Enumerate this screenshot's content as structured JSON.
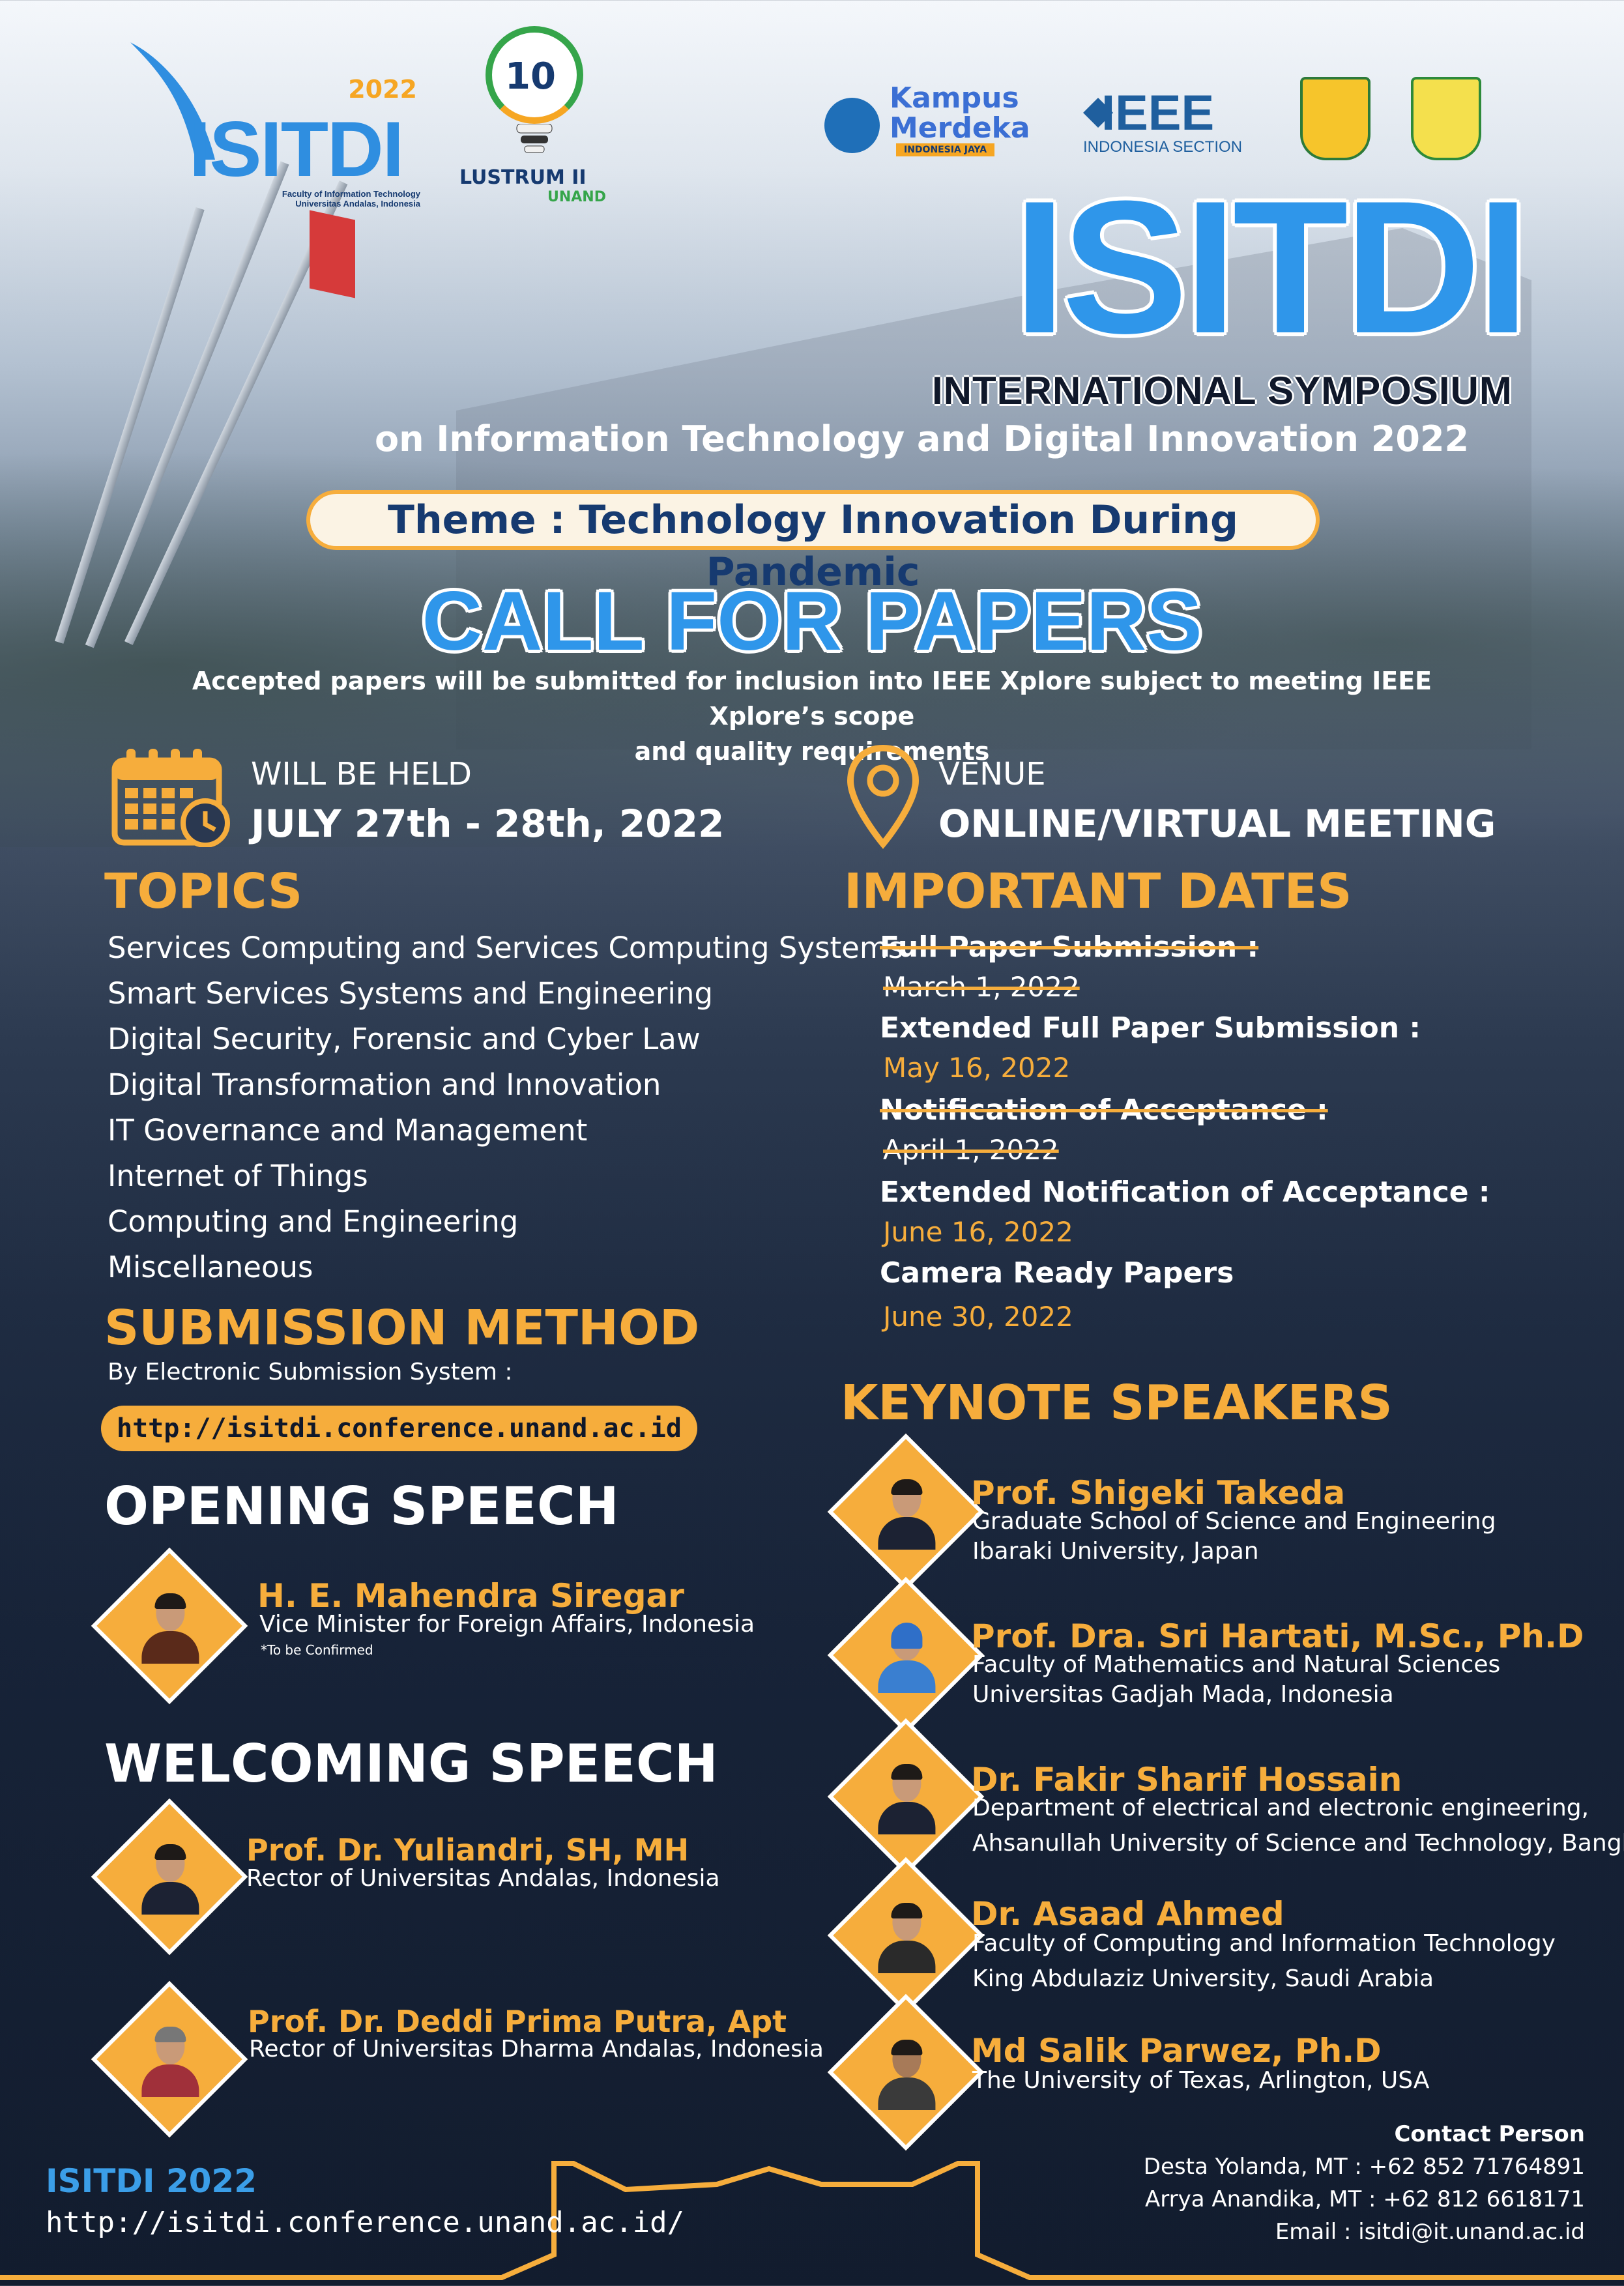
{
  "logos": {
    "isitdi_year": "2022",
    "isitdi_word": "ISITDI",
    "isitdi_sub_1": "Faculty of Information Technology",
    "isitdi_sub_2": "Universitas Andalas, Indonesia",
    "lustrum_number": "10",
    "lustrum_title": "LUSTRUM II",
    "lustrum_unand": "UNAND",
    "kampus_merdeka_1": "Kampus",
    "kampus_merdeka_2": "Merdeka",
    "kampus_merdeka_bar": "INDONESIA JAYA",
    "ieee_word": "IEEE",
    "ieee_sub": "INDONESIA SECTION"
  },
  "headline": {
    "title": "ISITDI",
    "subtitle": "INTERNATIONAL SYMPOSIUM",
    "tagline": "on Information Technology and Digital Innovation 2022",
    "theme": "Theme : Technology Innovation During Pandemic",
    "cfp": "CALL FOR PAPERS",
    "accepted_1": "Accepted papers will be submitted for inclusion into IEEE Xplore subject to meeting IEEE Xplore’s scope",
    "accepted_2": "and quality requirements"
  },
  "event": {
    "held_label": "WILL BE HELD",
    "held_value": "JULY 27th - 28th, 2022",
    "venue_label": "VENUE",
    "venue_value": "ONLINE/VIRTUAL MEETING"
  },
  "topics": {
    "heading": "TOPICS",
    "items": [
      "Services Computing and Services Computing Systems",
      "Smart Services Systems and Engineering",
      "Digital Security, Forensic and Cyber Law",
      "Digital Transformation and Innovation",
      "IT Governance and Management",
      "Internet of Things",
      "Computing and Engineering",
      "Miscellaneous"
    ]
  },
  "submission": {
    "heading": "SUBMISSION METHOD",
    "by": "By Electronic Submission System :",
    "link": "http://isitdi.conference.unand.ac.id"
  },
  "important_dates": {
    "heading": "IMPORTANT DATES",
    "items": [
      {
        "label": "Full Paper Submission :",
        "value": "March 1, 2022",
        "struck": true
      },
      {
        "label": "Extended Full Paper Submission :",
        "value": "May 16, 2022",
        "struck": false
      },
      {
        "label": "Notification of Acceptance :",
        "value": "April 1, 2022",
        "struck": true
      },
      {
        "label": "Extended Notification of Acceptance :",
        "value": "June 16, 2022",
        "struck": false
      },
      {
        "label": "Camera Ready Papers",
        "value": "June 30, 2022",
        "struck": false
      }
    ]
  },
  "opening": {
    "heading": "OPENING SPEECH",
    "name": "H. E. Mahendra Siregar",
    "aff": "Vice Minister for Foreign Affairs, Indonesia",
    "note": "*To be Confirmed"
  },
  "welcoming": {
    "heading": "WELCOMING SPEECH",
    "speakers": [
      {
        "name": "Prof. Dr. Yuliandri, SH, MH",
        "aff": "Rector of Universitas Andalas, Indonesia"
      },
      {
        "name": "Prof. Dr. Deddi Prima Putra, Apt",
        "aff": "Rector of Universitas Dharma Andalas, Indonesia"
      }
    ]
  },
  "keynote": {
    "heading": "KEYNOTE SPEAKERS",
    "speakers": [
      {
        "name": "Prof. Shigeki Takeda",
        "aff1": "Graduate School of Science and Engineering",
        "aff2": "Ibaraki University, Japan"
      },
      {
        "name": "Prof. Dra. Sri Hartati, M.Sc., Ph.D",
        "aff1": "Faculty of Mathematics and Natural Sciences",
        "aff2": "Universitas Gadjah Mada, Indonesia"
      },
      {
        "name": "Dr. Fakir Sharif Hossain",
        "aff1": "Department of electrical and electronic engineering,",
        "aff2": "Ahsanullah University of Science and Technology, Bangladesh"
      },
      {
        "name": "Dr. Asaad Ahmed",
        "aff1": "Faculty of Computing and Information Technology",
        "aff2": "King Abdulaziz University, Saudi Arabia"
      },
      {
        "name": "Md Salik Parwez, Ph.D",
        "aff1": "The University of Texas, Arlington, USA",
        "aff2": ""
      }
    ]
  },
  "footer": {
    "title": "ISITDI 2022",
    "url": "http://isitdi.conference.unand.ac.id/",
    "contact_title": "Contact Person",
    "contact_1": "Desta Yolanda, MT : +62 852 71764891",
    "contact_2": "Arrya Anandika, MT : +62 812 6618171",
    "contact_3": "Email : isitdi@it.unand.ac.id"
  },
  "colors": {
    "accent": "#f6ad3c",
    "blue": "#2f96ea",
    "navy": "#172338"
  }
}
